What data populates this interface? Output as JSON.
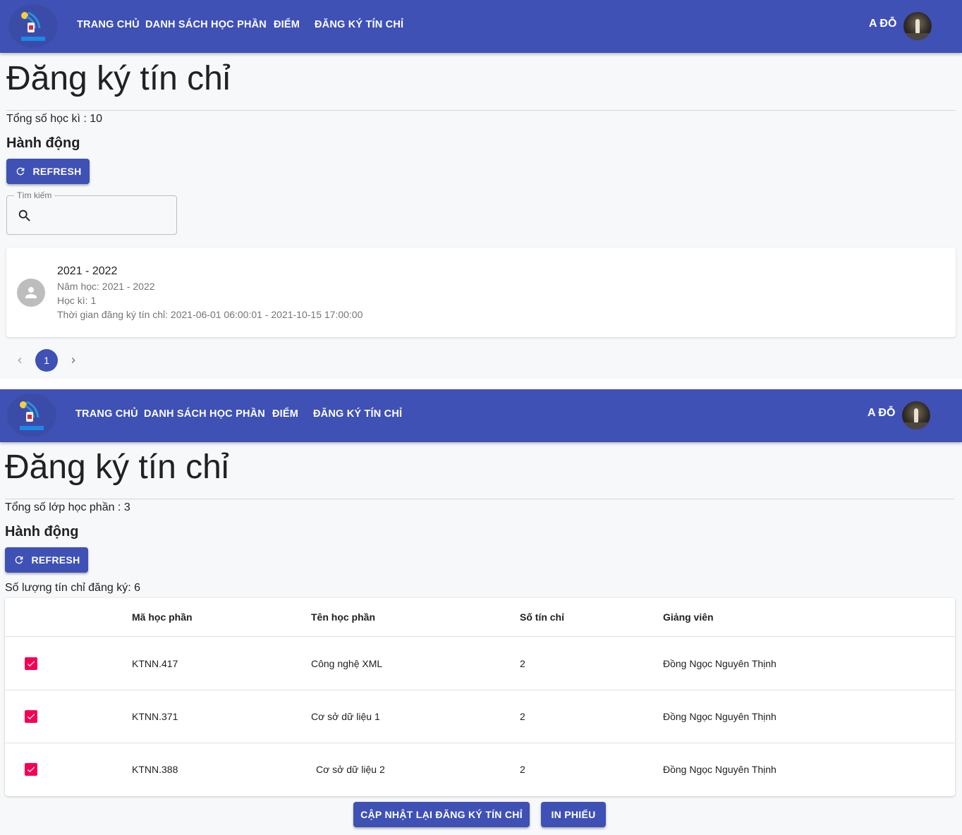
{
  "nav": {
    "items": [
      "TRANG CHỦ",
      "DANH SÁCH HỌC PHẦN",
      "ĐIỂM",
      "ĐĂNG KÝ TÍN CHỈ"
    ],
    "user": "A ĐỖ"
  },
  "colors": {
    "primary": "#3f51b5",
    "checkbox": "#f50057",
    "background": "#f7f8fa"
  },
  "semester_view": {
    "title": "Đăng ký tín chỉ",
    "total": "Tổng số học kì : 10",
    "actions_title": "Hành động",
    "refresh_label": "REFRESH",
    "search": {
      "label": "Tìm kiếm",
      "value": ""
    },
    "card": {
      "title": "2021 - 2022",
      "year": "Năm học: 2021 - 2022",
      "semester": "Học kì: 1",
      "period": "Thời gian đăng ký tín chỉ: 2021-06-01 06:00:01 - 2021-10-15 17:00:00"
    },
    "pagination": {
      "current": "1"
    }
  },
  "course_view": {
    "title": "Đăng ký tín chỉ",
    "total": "Tổng số lớp học phần : 3",
    "actions_title": "Hành động",
    "refresh_label": "REFRESH",
    "credits": "Số lượng tín chỉ đăng ký: 6",
    "table": {
      "headers": [
        "Mã học phần",
        "Tên học phần",
        "Số tín chỉ",
        "Giảng viên"
      ],
      "rows": [
        {
          "checked": true,
          "code": "KTNN.417",
          "name": "Công nghệ XML",
          "credits": "2",
          "lecturer": "Đồng Ngọc Nguyên Thịnh"
        },
        {
          "checked": true,
          "code": "KTNN.371",
          "name": "Cơ sở dữ liệu 1",
          "credits": "2",
          "lecturer": "Đồng Ngọc Nguyên Thịnh"
        },
        {
          "checked": true,
          "code": "KTNN.388",
          "name": "Cơ sở dữ liệu 2",
          "credits": "2",
          "lecturer": "Đồng Ngọc Nguyên Thịnh"
        }
      ]
    },
    "update_label": "CẬP NHẬT LẠI ĐĂNG KÝ TÍN CHỈ",
    "print_label": "IN PHIẾU"
  }
}
